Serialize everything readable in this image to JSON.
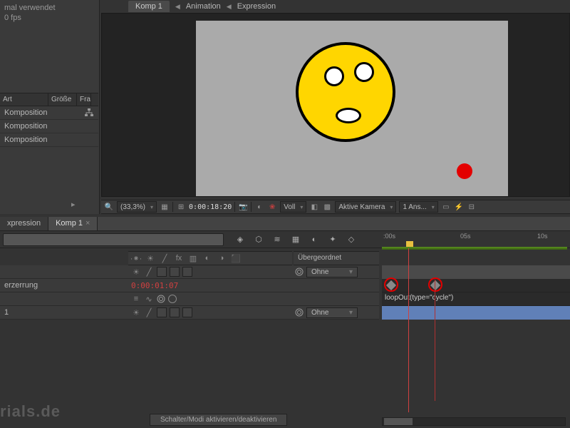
{
  "topleft": {
    "line1": "mal verwendet",
    "line2": "0 fps"
  },
  "project": {
    "cols": {
      "art": "Art",
      "size": "Größe",
      "fr": "Fra"
    },
    "rows": [
      {
        "type": "Komposition"
      },
      {
        "type": "Komposition"
      },
      {
        "type": "Komposition"
      }
    ]
  },
  "breadcrumb": {
    "items": [
      "Komp 1",
      "Animation",
      "Expression"
    ]
  },
  "viewerbar": {
    "zoom": "(33,3%)",
    "time": "0:00:18:20",
    "channel": "Voll",
    "camera": "Aktive Kamera",
    "views": "1 Ans..."
  },
  "timeline": {
    "tabs": [
      {
        "label": "xpression",
        "active": false
      },
      {
        "label": "Komp 1",
        "active": true
      }
    ],
    "ruler": {
      "t0": ":00s",
      "t1": "05s",
      "t2": "10s"
    },
    "parent_header": "Übergeordnet",
    "parent_none": "Ohne",
    "current_time": "0:00:01:07",
    "layer_prop": "erzerrung",
    "layer_name": "1",
    "expression": "loopOut(type=\"cycle\")"
  },
  "bottom": {
    "watermark": "rials.de",
    "toggle": "Schalter/Modi aktivieren/deaktivieren"
  }
}
